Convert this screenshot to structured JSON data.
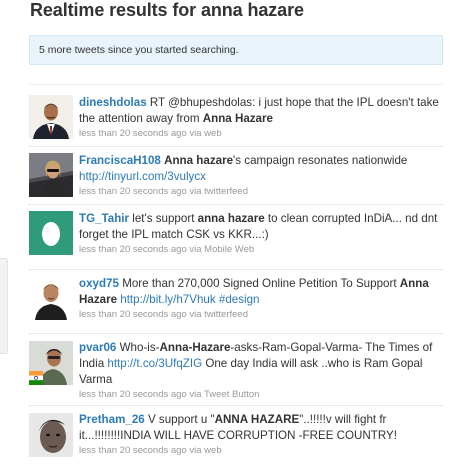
{
  "page": {
    "title": "Realtime results for anna hazare",
    "new_tweets_banner": "5 more tweets since you started searching."
  },
  "tweets": [
    {
      "user": "dineshdolas",
      "parts": [
        " RT @bhupeshdolas: i just hope that the IPL doesn't take the attention away from ",
        {
          "b": "Anna Hazare"
        }
      ],
      "time": "less than 20 seconds ago",
      "via": " via web",
      "avatar": "man-suit-avatar"
    },
    {
      "user": "FranciscaH108",
      "parts": [
        " ",
        {
          "b": "Anna hazare"
        },
        "'s campaign resonates nationwide ",
        {
          "a": "http://tinyurl.com/3vulycx"
        }
      ],
      "time": "less than 20 seconds ago",
      "via": " via twitterfeed",
      "avatar": "woman-car-avatar"
    },
    {
      "user": "TG_Tahir",
      "parts": [
        " let's support ",
        {
          "b": "anna hazare"
        },
        " to clean corrupted InDiA... nd dnt forget the IPL match CSK vs KKR...:)"
      ],
      "time": "less than 20 seconds ago",
      "via": " via Mobile Web",
      "avatar": "default-egg-avatar"
    },
    {
      "user": "oxyd75",
      "parts": [
        " More than 270,000 Signed Online Petition To Support ",
        {
          "b": "Anna Hazare"
        },
        " ",
        {
          "a": "http://bit.ly/h7Vhuk"
        },
        " ",
        {
          "a": "#design"
        }
      ],
      "time": "less than 20 seconds ago",
      "via": " via twitterfeed",
      "avatar": "man-portrait-avatar"
    },
    {
      "user": "pvar06",
      "parts": [
        " Who-is-",
        {
          "b": "Anna-Hazare"
        },
        "-asks-Ram-Gopal-Varma- The Times of India ",
        {
          "a": "http://t.co/3UfqZIG"
        },
        " One day India will ask ..who is Ram Gopal Varma"
      ],
      "time": "less than 20 seconds ago",
      "via": " via Tweet Button",
      "avatar": "man-flag-avatar"
    },
    {
      "user": "Pretham_26",
      "parts": [
        " V support u \"",
        {
          "b": "ANNA HAZARE"
        },
        "\"..!!!!!v will fight fr it...!!!!!!!!INDIA WILL HAVE CORRUPTION -FREE COUNTRY!"
      ],
      "time": "less than 20 seconds ago",
      "via": " via web",
      "avatar": "man-closeup-avatar"
    }
  ]
}
